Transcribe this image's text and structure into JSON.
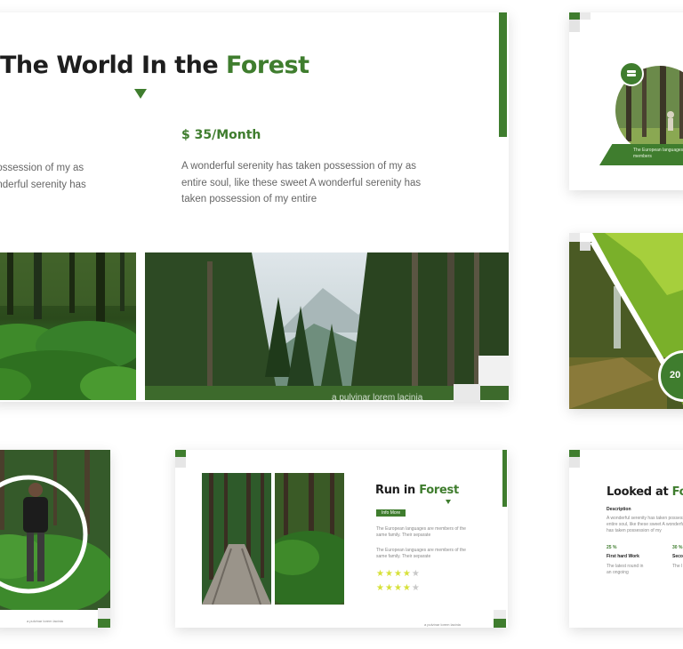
{
  "colors": {
    "accent": "#3f7d2e",
    "body_text": "#666666",
    "title": "#1e1e1e"
  },
  "main_slide": {
    "title_prefix": "The World In the ",
    "title_accent": "Forest",
    "price": "$ 35/Month",
    "left_text": [
      "possession of my as",
      "onderful serenity has"
    ],
    "right_text": "A wonderful serenity has taken possession of my as entire soul, like these sweet A wonderful serenity has taken possession of my entire",
    "image_caption": "a pulvinar lorem lacinia"
  },
  "slide_top_right": {
    "icon": "coin-icon",
    "caption": "The European languages are members"
  },
  "slide_mid_right": {
    "badge_text": "20"
  },
  "slide_bottom_left": {
    "footer": "a pulvinar lorem lacinia"
  },
  "slide_bottom_mid": {
    "title_prefix": "Run in ",
    "title_accent": "Forest",
    "badge": "Info More",
    "para1": "The European languages are members of the same family. Their separate",
    "para2": "The European languages are members of the same family. Their separate",
    "rating1": 4,
    "rating2": 4,
    "rating_max": 5,
    "footer": "a pulvinar lorem lacinia"
  },
  "slide_bottom_right": {
    "title_prefix": "Looked at ",
    "title_accent": "For",
    "desc_label": "Description",
    "desc_text": "A wonderful serenity has taken possession of my entire soul, like these sweet A wonderful serenity has taken possession of my",
    "stat1_value": "25 %",
    "stat1_label": "First hard Work",
    "stat1_text": "The latest round in an ongoing",
    "stat2_value": "30 %",
    "stat2_label": "Seco",
    "stat2_text": "The l"
  }
}
